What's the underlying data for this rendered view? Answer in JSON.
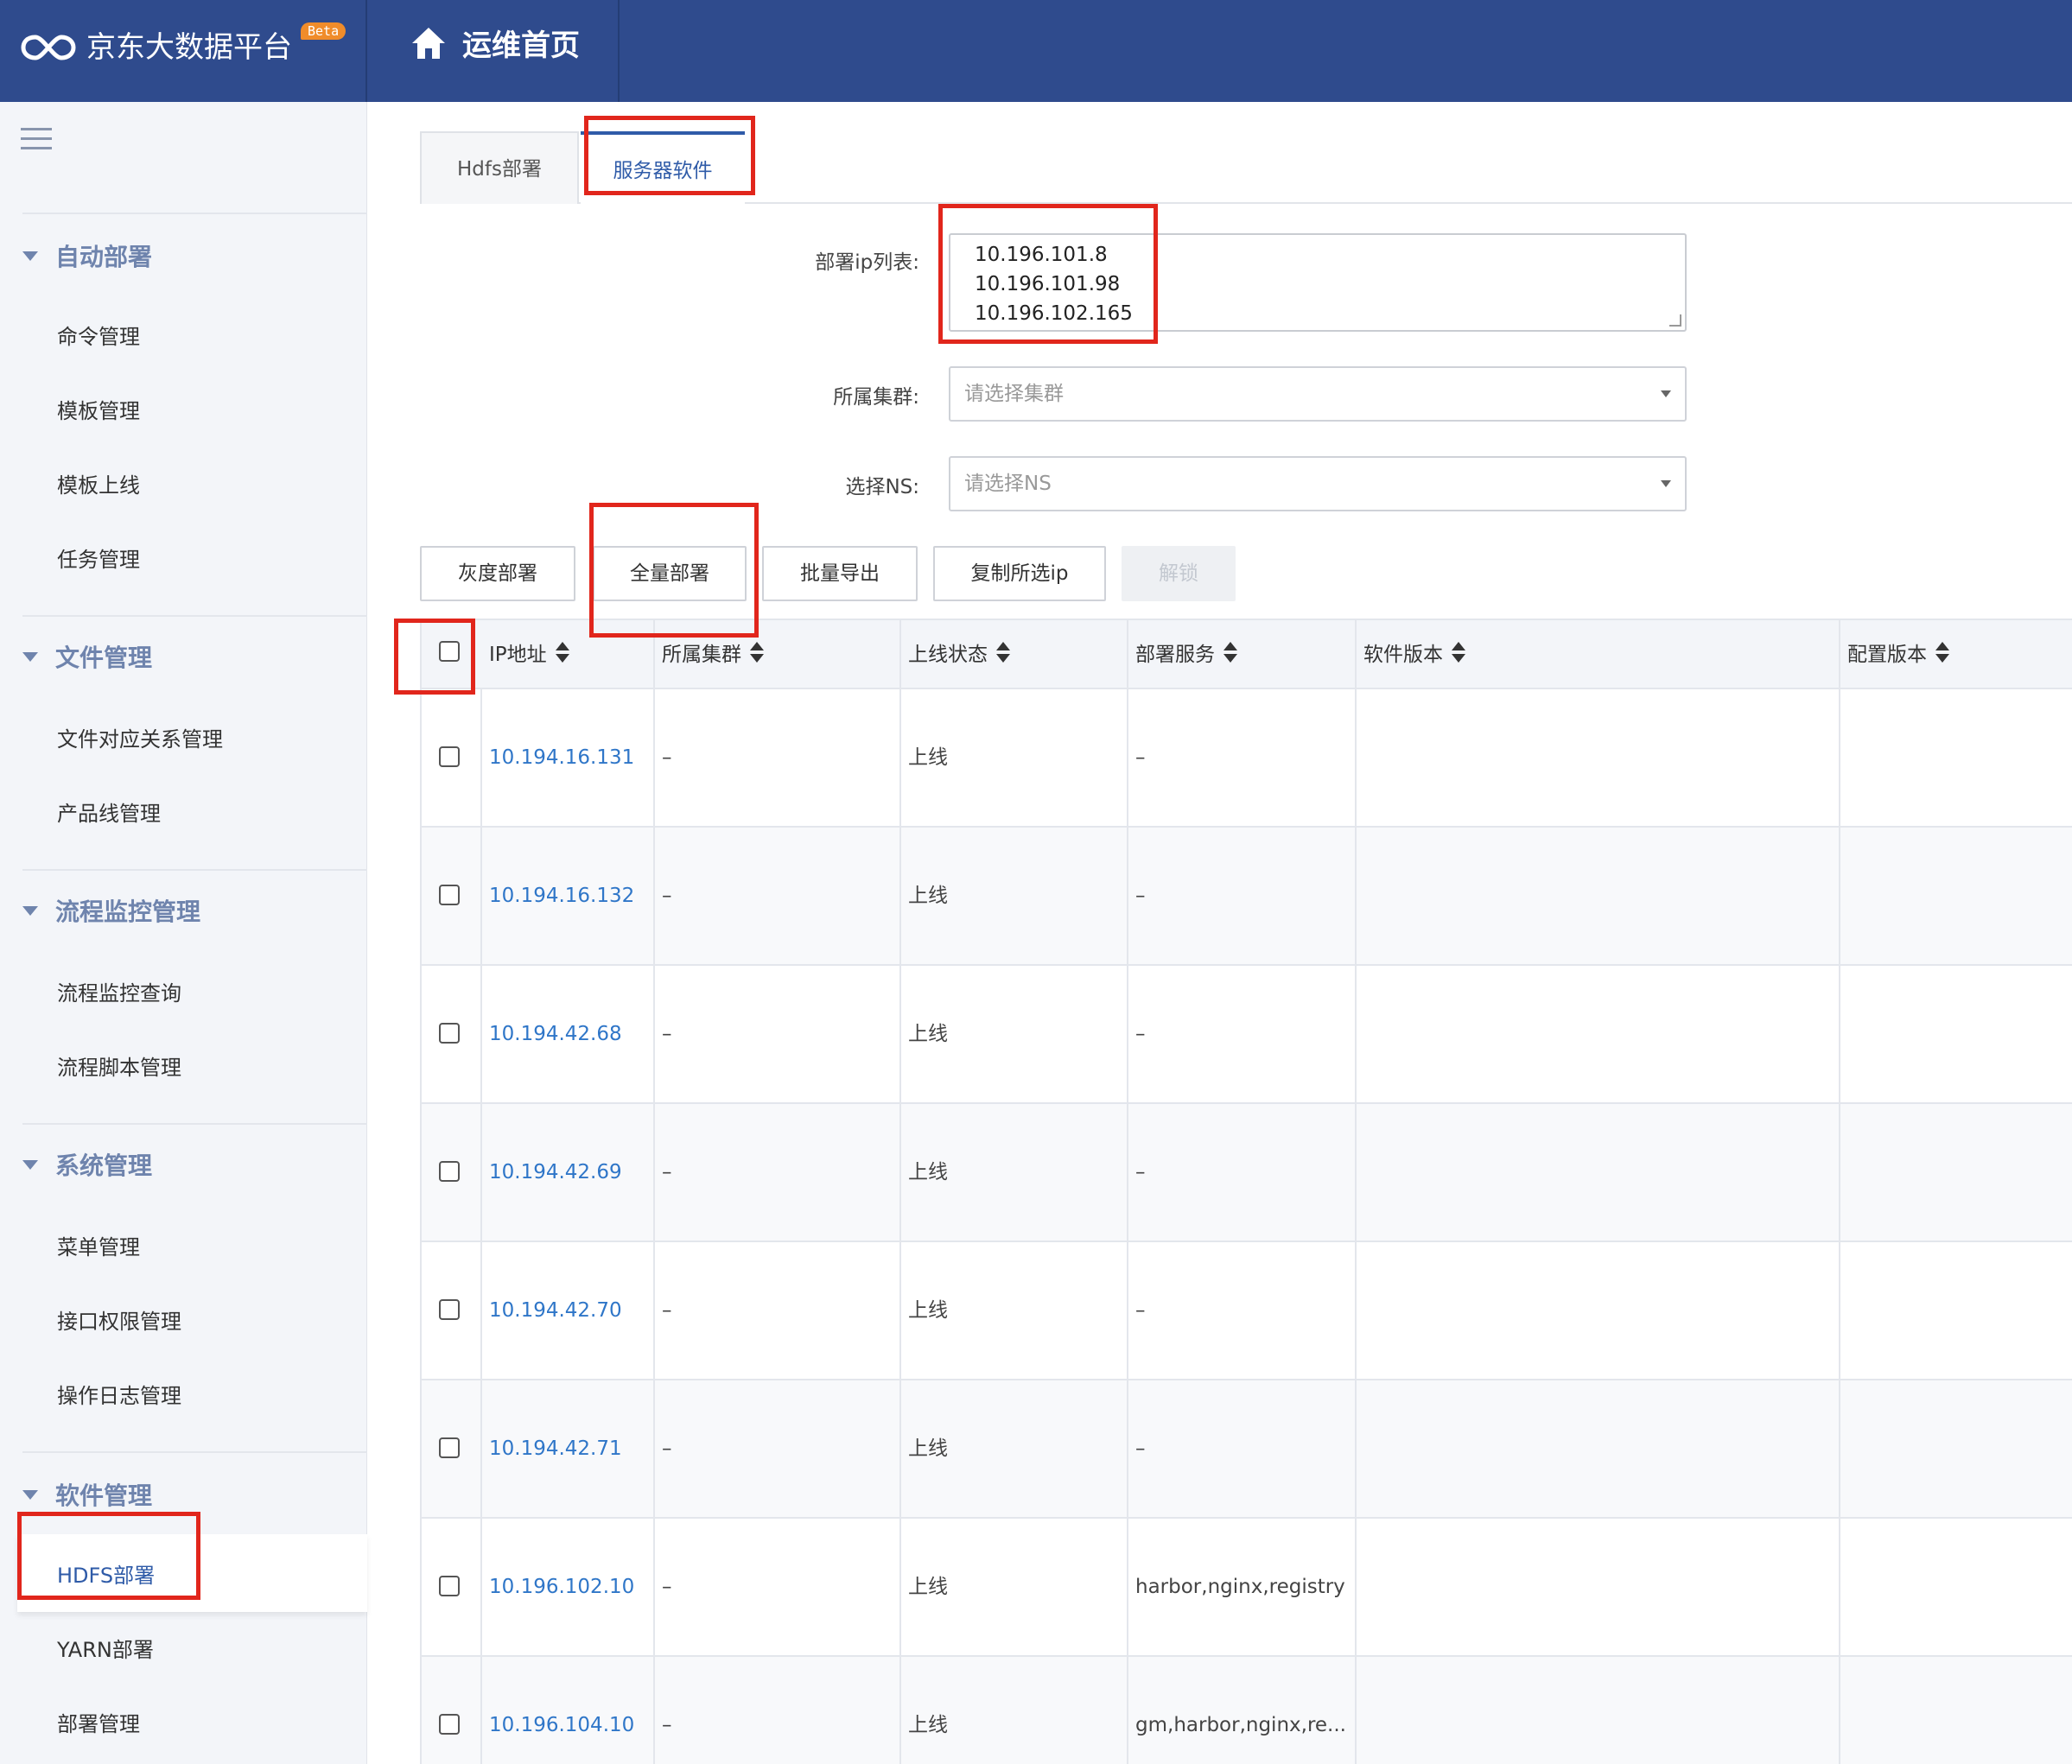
{
  "header": {
    "brand_title": "京东大数据平台",
    "beta_badge": "Beta",
    "page_title": "运维首页",
    "bg_color": "#2f4b8d"
  },
  "sidebar": {
    "groups": [
      {
        "title": "自动部署",
        "items": [
          "命令管理",
          "模板管理",
          "模板上线",
          "任务管理"
        ]
      },
      {
        "title": "文件管理",
        "items": [
          "文件对应关系管理",
          "产品线管理"
        ]
      },
      {
        "title": "流程监控管理",
        "items": [
          "流程监控查询",
          "流程脚本管理"
        ]
      },
      {
        "title": "系统管理",
        "items": [
          "菜单管理",
          "接口权限管理",
          "操作日志管理"
        ]
      },
      {
        "title": "软件管理",
        "items": [
          "HDFS部署",
          "YARN部署",
          "部署管理"
        ]
      }
    ],
    "active_item": "HDFS部署"
  },
  "tabs": [
    {
      "label": "Hdfs部署",
      "active": false
    },
    {
      "label": "服务器软件",
      "active": true
    }
  ],
  "form": {
    "ip_list_label": "部署ip列表:",
    "ip_list_lines": [
      "10.196.101.8",
      "10.196.101.98",
      "10.196.102.165"
    ],
    "cluster_label": "所属集群:",
    "cluster_placeholder": "请选择集群",
    "ns_label": "选择NS:",
    "ns_placeholder": "请选择NS"
  },
  "buttons": {
    "gray_deploy": "灰度部署",
    "full_deploy": "全量部署",
    "batch_export": "批量导出",
    "copy_ip": "复制所选ip",
    "unlock": "解锁"
  },
  "table": {
    "columns": [
      "IP地址",
      "所属集群",
      "上线状态",
      "部署服务",
      "软件版本",
      "配置版本"
    ],
    "rows": [
      {
        "ip": "10.194.16.131",
        "cluster": "–",
        "status": "上线",
        "service": "–",
        "software": "",
        "config": ""
      },
      {
        "ip": "10.194.16.132",
        "cluster": "–",
        "status": "上线",
        "service": "–",
        "software": "",
        "config": ""
      },
      {
        "ip": "10.194.42.68",
        "cluster": "–",
        "status": "上线",
        "service": "–",
        "software": "",
        "config": ""
      },
      {
        "ip": "10.194.42.69",
        "cluster": "–",
        "status": "上线",
        "service": "–",
        "software": "",
        "config": ""
      },
      {
        "ip": "10.194.42.70",
        "cluster": "–",
        "status": "上线",
        "service": "–",
        "software": "",
        "config": ""
      },
      {
        "ip": "10.194.42.71",
        "cluster": "–",
        "status": "上线",
        "service": "–",
        "software": "",
        "config": ""
      },
      {
        "ip": "10.196.102.10",
        "cluster": "–",
        "status": "上线",
        "service": "harbor,nginx,registry",
        "software": "",
        "config": ""
      },
      {
        "ip": "10.196.104.10",
        "cluster": "–",
        "status": "上线",
        "service": "gm,harbor,nginx,re...",
        "software": "",
        "config": ""
      }
    ]
  },
  "colors": {
    "accent": "#2f5ba8",
    "link": "#2f76c8",
    "highlight": "#e1261c"
  }
}
